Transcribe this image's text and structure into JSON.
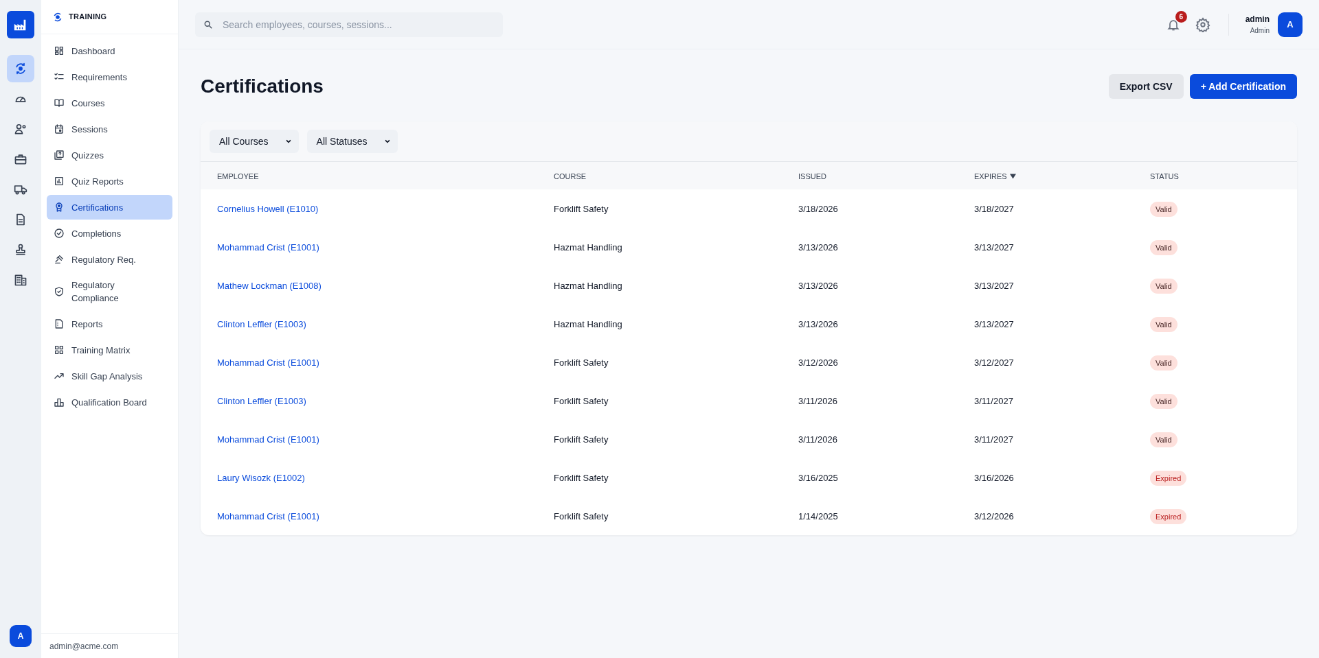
{
  "rail": {
    "items": [
      {
        "selected": true
      },
      {
        "selected": false
      },
      {
        "selected": false
      },
      {
        "selected": false
      },
      {
        "selected": false
      },
      {
        "selected": false
      },
      {
        "selected": false
      },
      {
        "selected": false
      }
    ],
    "avatar": "A"
  },
  "sidebar": {
    "title": "TRAINING",
    "items": [
      {
        "label": "Dashboard",
        "selected": false
      },
      {
        "label": "Requirements",
        "selected": false
      },
      {
        "label": "Courses",
        "selected": false
      },
      {
        "label": "Sessions",
        "selected": false
      },
      {
        "label": "Quizzes",
        "selected": false
      },
      {
        "label": "Quiz Reports",
        "selected": false
      },
      {
        "label": "Certifications",
        "selected": true
      },
      {
        "label": "Completions",
        "selected": false
      },
      {
        "label": "Regulatory Req.",
        "selected": false
      },
      {
        "label": "Regulatory Compliance",
        "selected": false
      },
      {
        "label": "Reports",
        "selected": false
      },
      {
        "label": "Training Matrix",
        "selected": false
      },
      {
        "label": "Skill Gap Analysis",
        "selected": false
      },
      {
        "label": "Qualification Board",
        "selected": false
      }
    ],
    "footer": "admin@acme.com"
  },
  "topbar": {
    "search": {
      "placeholder": "Search employees, courses, sessions..."
    },
    "notifications": "6",
    "user": {
      "name": "admin",
      "role": "Admin",
      "avatar": "A"
    }
  },
  "page": {
    "title": "Certifications",
    "buttons": [
      {
        "label": "Export CSV",
        "kind": "secondary"
      },
      {
        "label": "+ Add Certification",
        "kind": "primary"
      }
    ]
  },
  "filters": [
    {
      "value": "All Courses"
    },
    {
      "value": "All Statuses"
    }
  ],
  "table": {
    "columns": [
      {
        "label": "EMPLOYEE",
        "sorted": false
      },
      {
        "label": "COURSE",
        "sorted": false
      },
      {
        "label": "ISSUED",
        "sorted": false
      },
      {
        "label": "EXPIRES",
        "sorted": true
      },
      {
        "label": "STATUS",
        "sorted": false
      }
    ],
    "rows": [
      {
        "employee": "Cornelius Howell (E1010)",
        "course": "Forklift Safety",
        "issued": "3/18/2026",
        "expires": "3/18/2027",
        "status": {
          "label": "Valid",
          "kind": "valid"
        }
      },
      {
        "employee": "Mohammad Crist (E1001)",
        "course": "Hazmat Handling",
        "issued": "3/13/2026",
        "expires": "3/13/2027",
        "status": {
          "label": "Valid",
          "kind": "valid"
        }
      },
      {
        "employee": "Mathew Lockman (E1008)",
        "course": "Hazmat Handling",
        "issued": "3/13/2026",
        "expires": "3/13/2027",
        "status": {
          "label": "Valid",
          "kind": "valid"
        }
      },
      {
        "employee": "Clinton Leffler (E1003)",
        "course": "Hazmat Handling",
        "issued": "3/13/2026",
        "expires": "3/13/2027",
        "status": {
          "label": "Valid",
          "kind": "valid"
        }
      },
      {
        "employee": "Mohammad Crist (E1001)",
        "course": "Forklift Safety",
        "issued": "3/12/2026",
        "expires": "3/12/2027",
        "status": {
          "label": "Valid",
          "kind": "valid"
        }
      },
      {
        "employee": "Clinton Leffler (E1003)",
        "course": "Forklift Safety",
        "issued": "3/11/2026",
        "expires": "3/11/2027",
        "status": {
          "label": "Valid",
          "kind": "valid"
        }
      },
      {
        "employee": "Mohammad Crist (E1001)",
        "course": "Forklift Safety",
        "issued": "3/11/2026",
        "expires": "3/11/2027",
        "status": {
          "label": "Valid",
          "kind": "valid"
        }
      },
      {
        "employee": "Laury Wisozk (E1002)",
        "course": "Forklift Safety",
        "issued": "3/16/2025",
        "expires": "3/16/2026",
        "status": {
          "label": "Expired",
          "kind": "expired"
        }
      },
      {
        "employee": "Mohammad Crist (E1001)",
        "course": "Forklift Safety",
        "issued": "1/14/2025",
        "expires": "3/12/2026",
        "status": {
          "label": "Expired",
          "kind": "expired"
        }
      }
    ]
  }
}
